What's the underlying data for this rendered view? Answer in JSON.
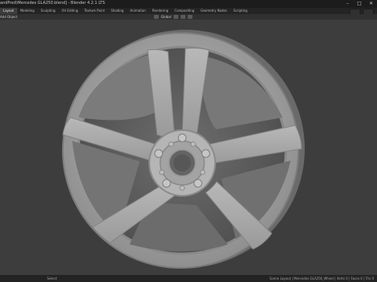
{
  "window": {
    "title": "andProd\\Mercedes GLA250.blend] - Blender 4.2.1 LTS",
    "buttons": [
      "–",
      "□",
      "✕"
    ]
  },
  "workspace_tabs": [
    {
      "label": "Layout",
      "active": true
    },
    {
      "label": "Modeling",
      "active": false
    },
    {
      "label": "Sculpting",
      "active": false
    },
    {
      "label": "UV Editing",
      "active": false
    },
    {
      "label": "Texture Paint",
      "active": false
    },
    {
      "label": "Shading",
      "active": false
    },
    {
      "label": "Animation",
      "active": false
    },
    {
      "label": "Rendering",
      "active": false
    },
    {
      "label": "Compositing",
      "active": false
    },
    {
      "label": "Geometry Nodes",
      "active": false
    },
    {
      "label": "Scripting",
      "active": false
    }
  ],
  "toolbar": {
    "menu_add": "Add",
    "menu_object": "Object",
    "transform_orientation": "Global",
    "pivot_icon": "pivot-point-icon",
    "snap_icon": "snap-icon",
    "proportional_icon": "proportional-edit-icon"
  },
  "status": {
    "left": "Select",
    "right": "Scene Layout | Mercedes GLA250_Wheel | Verts 0 | Faces 0 | Tris 0"
  },
  "colors": {
    "viewport_bg": "#3d3d3d",
    "wheel_face": "#a3a3a3",
    "wheel_dark": "#595959"
  }
}
